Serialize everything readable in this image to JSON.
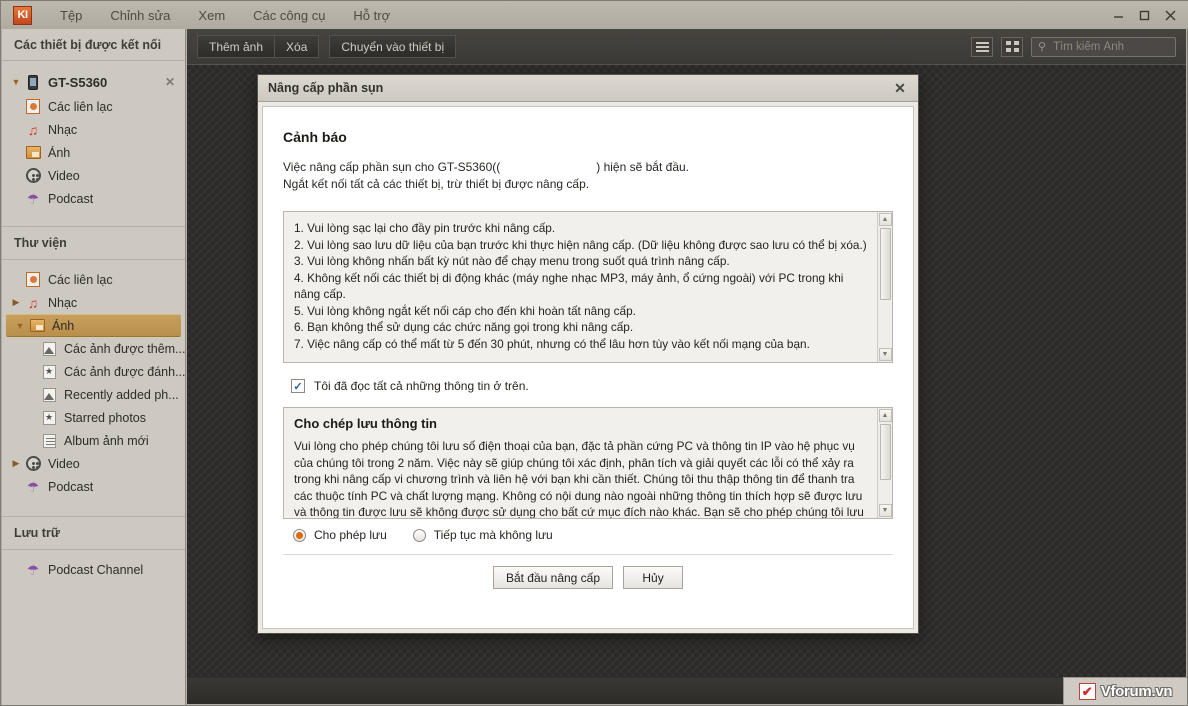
{
  "app": {
    "logo_text": "KI",
    "menu": [
      {
        "label": "Tệp"
      },
      {
        "label": "Chỉnh sửa"
      },
      {
        "label": "Xem"
      },
      {
        "label": "Các công cụ"
      },
      {
        "label": "Hỗ trợ"
      }
    ],
    "window_controls": {
      "minimize": "minimize-icon",
      "maximize": "maximize-icon",
      "close": "close-icon"
    }
  },
  "sidebar": {
    "connected_header": "Các thiết bị được kết nối",
    "device": {
      "name": "GT-S5360",
      "icon": "phone-icon",
      "expanded": true,
      "children": [
        {
          "label": "Các liên lạc",
          "icon": "contact-icon"
        },
        {
          "label": "Nhạc",
          "icon": "music-icon"
        },
        {
          "label": "Ảnh",
          "icon": "photo-icon"
        },
        {
          "label": "Video",
          "icon": "video-icon"
        },
        {
          "label": "Podcast",
          "icon": "podcast-icon"
        }
      ]
    },
    "library_header": "Thư viện",
    "library": [
      {
        "label": "Các liên lạc",
        "icon": "contact-icon",
        "twisty": "",
        "selected": false
      },
      {
        "label": "Nhạc",
        "icon": "music-icon",
        "twisty": "collapsed",
        "selected": false
      },
      {
        "label": "Ảnh",
        "icon": "photo-icon",
        "twisty": "expanded",
        "selected": true
      },
      {
        "label": "Các ảnh được thêm...",
        "icon": "mountain-icon",
        "twisty": "",
        "selected": false,
        "level": 3
      },
      {
        "label": "Các ảnh được đánh...",
        "icon": "star-icon",
        "twisty": "",
        "selected": false,
        "level": 3
      },
      {
        "label": "Recently added ph...",
        "icon": "mountain-icon",
        "twisty": "",
        "selected": false,
        "level": 3
      },
      {
        "label": "Starred photos",
        "icon": "star-icon",
        "twisty": "",
        "selected": false,
        "level": 3
      },
      {
        "label": "Album ảnh mới",
        "icon": "album-icon",
        "twisty": "",
        "selected": false,
        "level": 3
      },
      {
        "label": "Video",
        "icon": "video-icon",
        "twisty": "collapsed",
        "selected": false
      },
      {
        "label": "Podcast",
        "icon": "podcast-icon",
        "twisty": "",
        "selected": false
      }
    ],
    "storage_header": "Lưu trữ",
    "storage": [
      {
        "label": "Podcast Channel",
        "icon": "podcast-icon"
      }
    ]
  },
  "toolbar": {
    "add_photo_label": "Thêm ảnh",
    "delete_label": "Xóa",
    "transfer_label": "Chuyển vào thiết bị",
    "list_view_icon": "list-view-icon",
    "grid_view_icon": "grid-view-icon",
    "search_placeholder": "Tìm kiếm Ảnh",
    "search_value": ""
  },
  "dialog": {
    "title": "Nâng cấp phần sụn",
    "close_icon": "close-icon",
    "warning_heading": "Cảnh báo",
    "intro_line1_prefix": "Việc nâng cấp phần sụn cho GT-S5360((",
    "intro_line1_suffix": ") hiện sẽ bắt đầu.",
    "intro_line2": "Ngắt kết nối tất cả các thiết bị, trừ thiết bị được nâng cấp.",
    "warnings": [
      "1. Vui lòng sạc lại cho đầy pin trước khi nâng cấp.",
      "2. Vui lòng sao lưu dữ liệu của bạn trước khi thực hiện nâng cấp. (Dữ liệu không được sao lưu có thể bị xóa.)",
      "3. Vui lòng không nhấn bất kỳ nút nào để chạy menu trong suốt quá trình nâng cấp.",
      "4. Không kết nối các thiết bị di động khác (máy nghe nhạc MP3, máy ảnh, ổ cứng ngoài) với PC trong khi nâng cấp.",
      "5. Vui lòng không ngắt kết nối cáp cho đến khi hoàn tất nâng cấp.",
      "6. Bạn không thể sử dụng các chức năng gọi trong khi nâng cấp.",
      "7. Việc nâng cấp có thể mất từ 5 đến 30 phút, nhưng có thể lâu hơn tùy vào kết nối mạng của bạn."
    ],
    "checkbox_label": "Tôi đã đọc tất cả những thông tin ở trên.",
    "checkbox_checked": true,
    "consent_heading": "Cho chép lưu thông tin",
    "consent_text": "Vui lòng cho phép chúng tôi lưu số điện thoại của bạn, đặc tả phần cứng PC và thông tin IP vào hệ phục vụ của chúng tôi trong 2 năm. Việc này sẽ giúp chúng tôi xác định, phân tích và giải quyết các lỗi có thể xảy ra trong khi nâng cấp vi chương trình và liên hệ với bạn khi cần thiết. Chúng tôi thu thập thông tin để thanh tra các thuộc tính PC và chất lượng mạng. Không có nội dung nào ngoài những thông tin thích hợp sẽ được lưu và thông tin được lưu sẽ không được sử dụng cho bất cứ mục đích nào khác. Bạn sẽ cho phép chúng tôi lưu các thông tin này chứ?",
    "radios": [
      {
        "label": "Cho phép lưu",
        "selected": true
      },
      {
        "label": "Tiếp tục mà không lưu",
        "selected": false
      }
    ],
    "start_button": "Bắt đầu nâng cấp",
    "cancel_button": "Hủy"
  },
  "watermark": {
    "logo": "check-icon",
    "text": "Vforum.vn"
  },
  "colors": {
    "accent_orange": "#e06a10",
    "selection": "#b98f4b",
    "toolbar_dark": "#3c3a36",
    "logo_red": "#c2461c"
  }
}
